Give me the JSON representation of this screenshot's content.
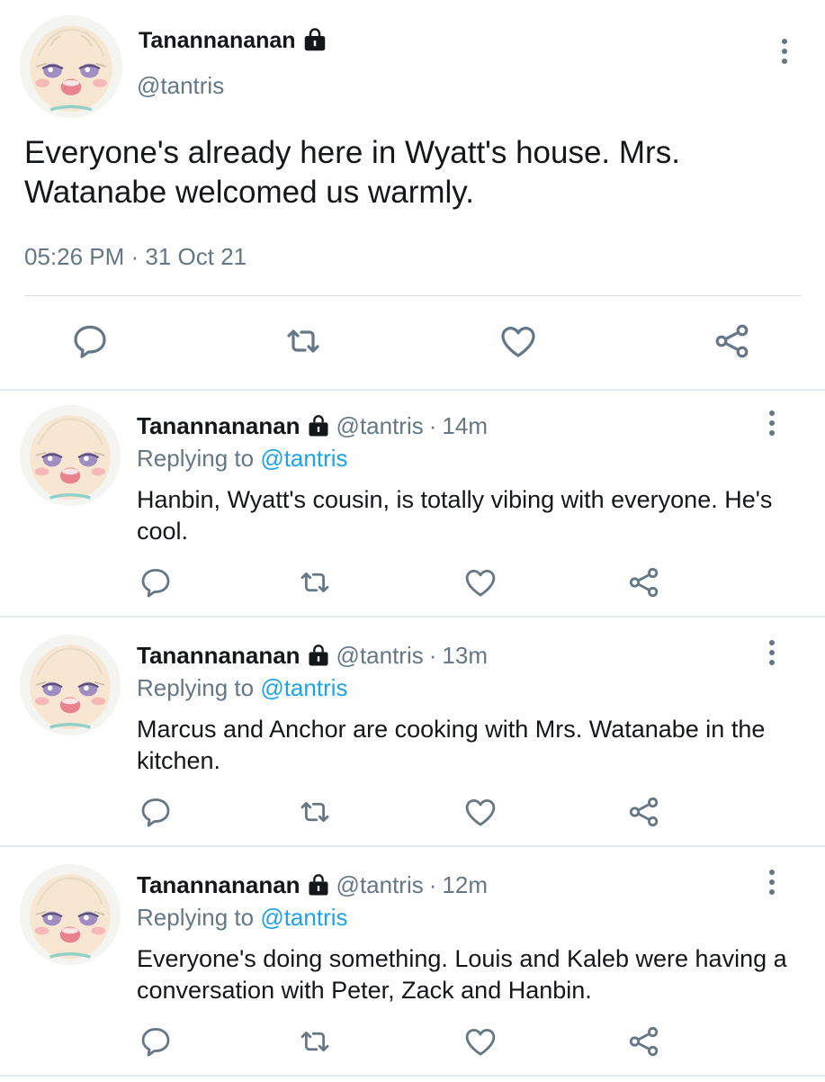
{
  "main_tweet": {
    "display_name": "Tanannananan",
    "handle": "@tantris",
    "text": "Everyone's already here in Wyatt's house. Mrs. Watanabe welcomed us warmly.",
    "timestamp": "05:26 PM · 31 Oct 21"
  },
  "replies": [
    {
      "display_name": "Tanannananan",
      "handle": "@tantris",
      "separator": "·",
      "time": "14m",
      "replying_prefix": "Replying to ",
      "replying_to": "@tantris",
      "text": "Hanbin, Wyatt's cousin, is totally vibing with everyone. He's cool."
    },
    {
      "display_name": "Tanannananan",
      "handle": "@tantris",
      "separator": "·",
      "time": "13m",
      "replying_prefix": "Replying to ",
      "replying_to": "@tantris",
      "text": "Marcus and Anchor are cooking with Mrs. Watanabe in the kitchen."
    },
    {
      "display_name": "Tanannananan",
      "handle": "@tantris",
      "separator": "·",
      "time": "12m",
      "replying_prefix": "Replying to ",
      "replying_to": "@tantris",
      "text": "Everyone's doing something. Louis and Kaleb were having a conversation with Peter, Zack and Hanbin."
    }
  ],
  "icons": {
    "reply": "speech-bubble-icon",
    "retweet": "retweet-icon",
    "like": "heart-icon",
    "share": "share-nodes-icon",
    "more": "vertical-ellipsis-icon",
    "protected": "lock-icon"
  },
  "colors": {
    "text": "#14171a",
    "secondary": "#657786",
    "mention": "#1da1f2",
    "divider": "#e6ecf0"
  }
}
